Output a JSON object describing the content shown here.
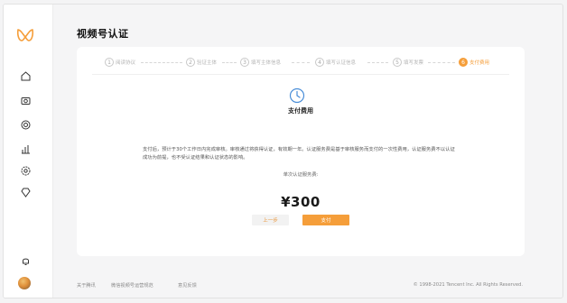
{
  "page": {
    "title": "视频号认证"
  },
  "colors": {
    "accent": "#f59e3a",
    "sidebar_bg": "#ffffff",
    "page_bg": "#f5f5f6"
  },
  "sidebar": {
    "logo": "channels-logo-icon",
    "items": [
      {
        "icon": "home-icon"
      },
      {
        "icon": "camera-icon"
      },
      {
        "icon": "live-icon"
      },
      {
        "icon": "data-icon"
      },
      {
        "icon": "settings-icon"
      },
      {
        "icon": "shop-icon"
      },
      {
        "icon": "notification-icon"
      }
    ],
    "avatar": "avatar"
  },
  "steps": [
    {
      "num": "1",
      "label": "阅读协议",
      "active": false
    },
    {
      "num": "2",
      "label": "验证主体",
      "active": false
    },
    {
      "num": "3",
      "label": "填写主体信息",
      "active": false
    },
    {
      "num": "4",
      "label": "填写认证信息",
      "active": false
    },
    {
      "num": "5",
      "label": "填写发票",
      "active": false
    },
    {
      "num": "6",
      "label": "支付费用",
      "active": true
    }
  ],
  "main": {
    "heading": "支付费用",
    "description": "支付后，预计于30个工作日内完成审核。审核通过将获得认证，有效期一年。认证服务费是基于审核服务而支付的一次性费用，认证服务费不以认证成功为前提，也不受认证结果和认证状态的影响。",
    "fee_label": "单次认证服务费:",
    "price": "¥300",
    "prev_button": "上一步",
    "pay_button": "支付"
  },
  "footer": {
    "links": [
      "关于腾讯",
      "微信视频号运营规范",
      "意见反馈"
    ],
    "copyright": "© 1998-2021 Tencent Inc. All Rights Reserved."
  }
}
